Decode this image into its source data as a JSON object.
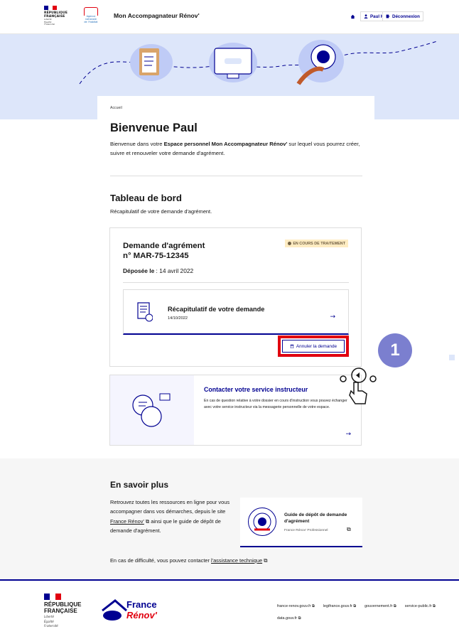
{
  "header": {
    "gov_brand": [
      "RÉPUBLIQUE",
      "FRANÇAISE"
    ],
    "gov_motto": [
      "Liberté",
      "Égalité",
      "Fraternité"
    ],
    "agency_logo_text": [
      "Agence",
      "nationale",
      "de l'habitat"
    ],
    "app_title": "Mon Accompagnateur Rénov'",
    "user_label": "Paul Hochon",
    "logout_label": "Déconnexion"
  },
  "breadcrumb": "Accueil",
  "welcome": {
    "title": "Bienvenue Paul",
    "intro_prefix": "Bienvenue dans votre ",
    "intro_bold": "Espace personnel Mon Accompagnateur Rénov'",
    "intro_suffix": " sur lequel vous pourrez créer, suivre et renouveler votre demande d'agrément."
  },
  "dashboard": {
    "title": "Tableau de bord",
    "subtitle": "Récapitulatif de votre demande d'agrément."
  },
  "demande": {
    "title_line1": "Demande d'agrément",
    "title_line2": "n° MAR-75-12345",
    "status": "EN COURS DE TRAITEMENT",
    "deposee_label": "Déposée le",
    "deposee_value": " : 14 avril 2022",
    "recap_title": "Récapitulatif de votre demande",
    "recap_date": "14/10/2022",
    "cancel_label": "Annuler la demande"
  },
  "contact": {
    "title": "Contacter votre service instructeur",
    "text": "En cas de question relative à votre dossier en cours d'instruction vous pouvez échanger avec votre service instructeur via la messagerie personnelle de votre espace."
  },
  "annotation": {
    "step_number": "1"
  },
  "savoir": {
    "title": "En savoir plus",
    "text_part1": "Retrouvez toutes les ressources en ligne pour vous accompagner dans vos démarches, depuis le site ",
    "link": "France Rénov'",
    "text_part2": " ainsi que le guide de dépôt de demande d'agrément.",
    "guide_title": "Guide de dépôt de demande d'agrément",
    "guide_sub": "France Rénov' Professionnel",
    "assist_prefix": "En cas de difficulté, vous pouvez contacter ",
    "assist_link": "l'assistance technique"
  },
  "footer": {
    "gov_brand": [
      "RÉPUBLIQUE",
      "FRANÇAISE"
    ],
    "gov_motto": [
      "Liberté",
      "Égalité",
      "Fraternité"
    ],
    "brand_line1": "France",
    "brand_line2": "Rénov'",
    "links": [
      "france-renov.gouv.fr",
      "legifrance.gouv.fr",
      "gouvernement.fr",
      "service-public.fr",
      "data.gouv.fr"
    ]
  },
  "colors": {
    "blue_france": "#000091",
    "red_marianne": "#e1000f",
    "hero_bg": "#dde6fa",
    "badge_bg": "#feecc2",
    "step_circle": "#7b7fcf"
  }
}
